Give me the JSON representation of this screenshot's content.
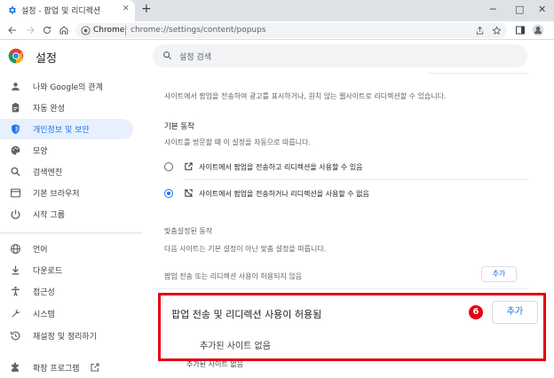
{
  "browser": {
    "tab_title": "설정 - 팝업 및 리디렉션",
    "new_tab": "+",
    "window_controls": {
      "minimize": "─",
      "maximize": "□",
      "close": "✕"
    },
    "site_label": "Chrome",
    "url": "chrome://settings/content/popups"
  },
  "settings": {
    "title": "설정",
    "search_placeholder": "설정 검색"
  },
  "sidebar": {
    "items": [
      {
        "label": "나와 Google의 관계",
        "icon": "person-icon"
      },
      {
        "label": "자동 완성",
        "icon": "clipboard-icon"
      },
      {
        "label": "개인정보 및 보안",
        "icon": "shield-icon",
        "active": true
      },
      {
        "label": "모양",
        "icon": "palette-icon"
      },
      {
        "label": "검색엔진",
        "icon": "search-icon"
      },
      {
        "label": "기본 브라우저",
        "icon": "browser-icon"
      },
      {
        "label": "시작 그룹",
        "icon": "power-icon"
      },
      {
        "label": "언어",
        "icon": "globe-icon"
      },
      {
        "label": "다운로드",
        "icon": "download-icon"
      },
      {
        "label": "접근성",
        "icon": "accessibility-icon"
      },
      {
        "label": "시스템",
        "icon": "wrench-icon"
      },
      {
        "label": "재설정 및 정리하기",
        "icon": "history-icon"
      },
      {
        "label": "확장 프로그램",
        "icon": "puzzle-icon"
      }
    ]
  },
  "content": {
    "intro": "사이트에서 팝업을 전송하여 광고를 표시하거나, 원치 않는 웹사이트로 리디렉션할 수 있습니다.",
    "default_heading": "기본 동작",
    "default_desc": "사이트를 방문할 때 이 설정을 자동으로 따릅니다.",
    "option_allow": "사이트에서 팝업을 전송하고 리디렉션을 사용할 수 있음",
    "option_block": "사이트에서 팝업을 전송하거나 리디렉션을 사용할 수 없음",
    "custom_heading": "맞춤설정된 동작",
    "custom_desc": "다음 사이트는 기본 설정이 아닌 맞춤 설정을 따릅니다.",
    "not_allowed_label": "팝업 전송 또는 리디렉션 사용이 허용되지 않음",
    "add_button": "추가"
  },
  "highlight": {
    "title": "팝업 전송 및 리디렉션 사용이 허용됨",
    "step_number": "6",
    "add_button": "추가",
    "empty_text": "추가된 사이트 없음",
    "border_color": "#e50012"
  },
  "peek_text": "추가된 사이트 없음",
  "colors": {
    "accent": "#1a73e8",
    "active_bg": "#e8f0fe",
    "highlight": "#e50012"
  }
}
